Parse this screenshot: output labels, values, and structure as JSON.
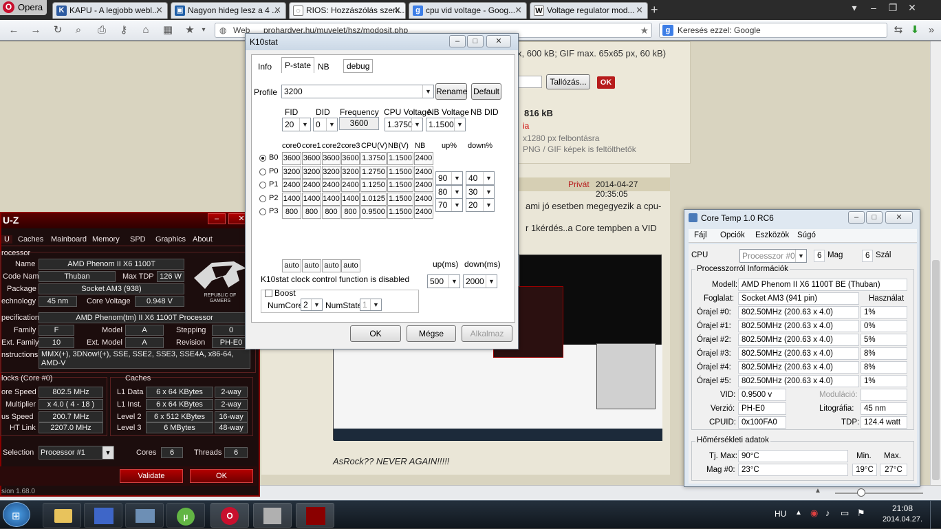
{
  "browser": {
    "opera_label": "Opera",
    "tabs": [
      {
        "label": "KAPU - A legjobb webl...",
        "fav": "K"
      },
      {
        "label": "Nagyon hideg lesz a 4 ...",
        "fav": "▣"
      },
      {
        "label": "RIOS: Hozzászólás szerk...",
        "fav": "◌"
      },
      {
        "label": "cpu vid voltage - Goog...",
        "fav": "g"
      },
      {
        "label": "Voltage regulator mod...",
        "fav": "W"
      }
    ],
    "address_prefix": "Web",
    "address": "prohardver.hu/muvelet/hsz/modosit.php",
    "search_placeholder": "Keresés ezzel: Google",
    "colors": {
      "accent": "#c8102e",
      "page_bg": "#eae6d7"
    }
  },
  "page": {
    "upload_info": "x, 600 kB; GIF max. 65x65 px, 60 kB)",
    "browse_button": "Tallózás...",
    "ok_button": "OK",
    "size": "816 kB",
    "link_fragment": "ia",
    "resolution_note": "x1280 px felbontásra",
    "format_note": "PNG / GIF képek is feltölthetők",
    "post_private": "Privát",
    "post_date": "2014-04-27 20:35:05",
    "post_line1": "ami jó esetben megegyezik a cpu-",
    "post_line2": "r 1kérdés..a Core tempben a VID",
    "post_footer": "AsRock?? NEVER AGAIN!!!!!"
  },
  "k10": {
    "title": "K10stat",
    "tabs": [
      "Info",
      "P-state",
      "NB",
      "debug"
    ],
    "profile_label": "Profile",
    "profile_value": "3200",
    "rename": "Rename",
    "default": "Default",
    "hdr": {
      "fid": "FID",
      "did": "DID",
      "freq": "Frequency",
      "cpuv": "CPU Voltage",
      "nbv": "NB Voltage",
      "nbdid": "NB DID"
    },
    "fid_value": "20",
    "did_value": "0",
    "freq_value": "3600",
    "cpuv_value": "1.3750",
    "nbv_value": "1.1500",
    "table_headers": [
      "core0",
      "core1",
      "core2",
      "core3",
      "CPU(V)",
      "NB(V)",
      "NB",
      "up%",
      "down%"
    ],
    "rows": [
      {
        "name": "B0",
        "vals": [
          "3600",
          "3600",
          "3600",
          "3600",
          "1.3750",
          "1.1500",
          "2400"
        ]
      },
      {
        "name": "P0",
        "vals": [
          "3200",
          "3200",
          "3200",
          "3200",
          "1.2750",
          "1.1500",
          "2400"
        ]
      },
      {
        "name": "P1",
        "vals": [
          "2400",
          "2400",
          "2400",
          "2400",
          "1.1250",
          "1.1500",
          "2400"
        ]
      },
      {
        "name": "P2",
        "vals": [
          "1400",
          "1400",
          "1400",
          "1400",
          "1.0125",
          "1.1500",
          "2400"
        ]
      },
      {
        "name": "P3",
        "vals": [
          "800",
          "800",
          "800",
          "800",
          "0.9500",
          "1.1500",
          "2400"
        ]
      }
    ],
    "up_values": [
      "90",
      "80",
      "70"
    ],
    "down_values": [
      "40",
      "30",
      "20"
    ],
    "auto": "auto",
    "up_ms_label": "up(ms)",
    "down_ms_label": "down(ms)",
    "up_ms": "500",
    "down_ms": "2000",
    "disabled_msg": "K10stat clock control function is disabled",
    "boost": "Boost",
    "numcore_label": "NumCore",
    "numcore": "2",
    "numstate_label": "NumState",
    "numstate": "1",
    "ok": "OK",
    "cancel": "Mégse",
    "apply": "Alkalmaz"
  },
  "cpuz": {
    "title": "U-Z",
    "tabs": [
      "U",
      "Caches",
      "Mainboard",
      "Memory",
      "SPD",
      "Graphics",
      "About"
    ],
    "section_processor": "rocessor",
    "name_label": "Name",
    "name": "AMD Phenom II X6 1100T",
    "codename_label": "Code Name",
    "codename": "Thuban",
    "maxtdp_label": "Max TDP",
    "maxtdp": "126 W",
    "package_label": "Package",
    "package": "Socket AM3 (938)",
    "tech_label": "echnology",
    "tech": "45 nm",
    "corev_label": "Core Voltage",
    "corev": "0.948 V",
    "spec_label": "pecification",
    "spec": "AMD Phenom(tm) II X6 1100T Processor",
    "family_label": "Family",
    "family": "F",
    "model_label": "Model",
    "model": "A",
    "stepping_label": "Stepping",
    "stepping": "0",
    "extfamily_label": "Ext. Family",
    "extfamily": "10",
    "extmodel_label": "Ext. Model",
    "extmodel": "A",
    "revision_label": "Revision",
    "revision": "PH-E0",
    "instr_label": "nstructions",
    "instr": "MMX(+), 3DNow!(+), SSE, SSE2, SSE3, SSE4A, x86-64, AMD-V",
    "clocks_title": "locks (Core #0)",
    "corespeed_label": "ore Speed",
    "corespeed": "802.5 MHz",
    "mult_label": "Multiplier",
    "mult": "x 4.0 ( 4 - 18 )",
    "bus_label": "us Speed",
    "bus": "200.7 MHz",
    "ht_label": "HT Link",
    "ht": "2207.0 MHz",
    "caches_title": "Caches",
    "l1d_label": "L1 Data",
    "l1d": "6 x 64 KBytes",
    "l1d_way": "2-way",
    "l1i_label": "L1 Inst.",
    "l1i": "6 x 64 KBytes",
    "l1i_way": "2-way",
    "l2_label": "Level 2",
    "l2": "6 x 512 KBytes",
    "l2_way": "16-way",
    "l3_label": "Level 3",
    "l3": "6 MBytes",
    "l3_way": "48-way",
    "selection_label": "Selection",
    "selection": "Processor #1",
    "cores_label": "Cores",
    "cores": "6",
    "threads_label": "Threads",
    "threads": "6",
    "validate": "Validate",
    "ok": "OK",
    "version": "sion 1.68.0",
    "logo_line1": "REPUBLIC OF",
    "logo_line2": "GAMERS"
  },
  "coretemp": {
    "title": "Core Temp 1.0 RC6",
    "menu": [
      "Fájl",
      "Opciók",
      "Eszközök",
      "Súgó"
    ],
    "cpu_label": "CPU",
    "cpu_select": "Processzor #0",
    "cores": "6",
    "cores_label": "Mag",
    "threads": "6",
    "threads_label": "Szál",
    "info_title": "Processzorról Információk",
    "model_label": "Modell:",
    "model": "AMD Phenom II X6 1100T BE (Thuban)",
    "socket_label": "Foglalat:",
    "socket": "Socket AM3 (941 pin)",
    "usage_label": "Használat",
    "clocks": [
      {
        "label": "Órajel #0:",
        "value": "802.50MHz (200.63 x 4.0)",
        "load": "1%"
      },
      {
        "label": "Órajel #1:",
        "value": "802.50MHz (200.63 x 4.0)",
        "load": "0%"
      },
      {
        "label": "Órajel #2:",
        "value": "802.50MHz (200.63 x 4.0)",
        "load": "5%"
      },
      {
        "label": "Órajel #3:",
        "value": "802.50MHz (200.63 x 4.0)",
        "load": "8%"
      },
      {
        "label": "Órajel #4:",
        "value": "802.50MHz (200.63 x 4.0)",
        "load": "8%"
      },
      {
        "label": "Órajel #5:",
        "value": "802.50MHz (200.63 x 4.0)",
        "load": "1%"
      }
    ],
    "vid_label": "VID:",
    "vid": "0.9500 v",
    "mod_label": "Moduláció:",
    "rev_label": "Verzió:",
    "rev": "PH-E0",
    "lith_label": "Litográfia:",
    "lith": "45 nm",
    "cpuid_label": "CPUID:",
    "cpuid": "0x100FA0",
    "tdp_label": "TDP:",
    "tdp": "124.4 watt",
    "temp_title": "Hőmérsékleti adatok",
    "min_label": "Min.",
    "max_label": "Max.",
    "tjmax_label": "Tj. Max:",
    "tjmax": "90°C",
    "core0_label": "Mag #0:",
    "core0": "23°C",
    "core0_min": "19°C",
    "core0_max": "27°C"
  },
  "taskbar": {
    "lang": "HU",
    "time": "21:08",
    "date": "2014.04.27."
  }
}
